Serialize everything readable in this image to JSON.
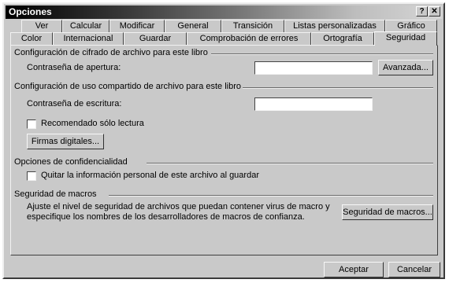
{
  "window": {
    "title": "Opciones",
    "help_label": "?",
    "close_label": "✕"
  },
  "tabs_row1": [
    "Ver",
    "Calcular",
    "Modificar",
    "General",
    "Transición",
    "Listas personalizadas",
    "Gráfico"
  ],
  "tabs_row2": [
    "Color",
    "Internacional",
    "Guardar",
    "Comprobación de errores",
    "Ortografía",
    "Seguridad"
  ],
  "active_tab": "Seguridad",
  "security": {
    "encrypt_group": "Configuración de cifrado de archivo para este libro",
    "open_password_label": "Contraseña de apertura:",
    "open_password_value": "",
    "advanced_button": "Avanzada...",
    "sharing_group": "Configuración de uso compartido de archivo para este libro",
    "write_password_label": "Contraseña de escritura:",
    "write_password_value": "",
    "read_only_label": "Recomendado sólo lectura",
    "digital_signatures_button": "Firmas digitales...",
    "privacy_group": "Opciones de confidencialidad",
    "remove_personal_info_label": "Quitar la información personal de este archivo al guardar",
    "macro_group": "Seguridad de macros",
    "macro_description_line1": "Ajuste el nivel de seguridad de archivos que puedan contener virus de macro y",
    "macro_description_line2": "especifique los nombres de los desarrolladores de macros de confianza.",
    "macro_security_button": "Seguridad de macros..."
  },
  "footer": {
    "ok_button": "Aceptar",
    "cancel_button": "Cancelar"
  }
}
